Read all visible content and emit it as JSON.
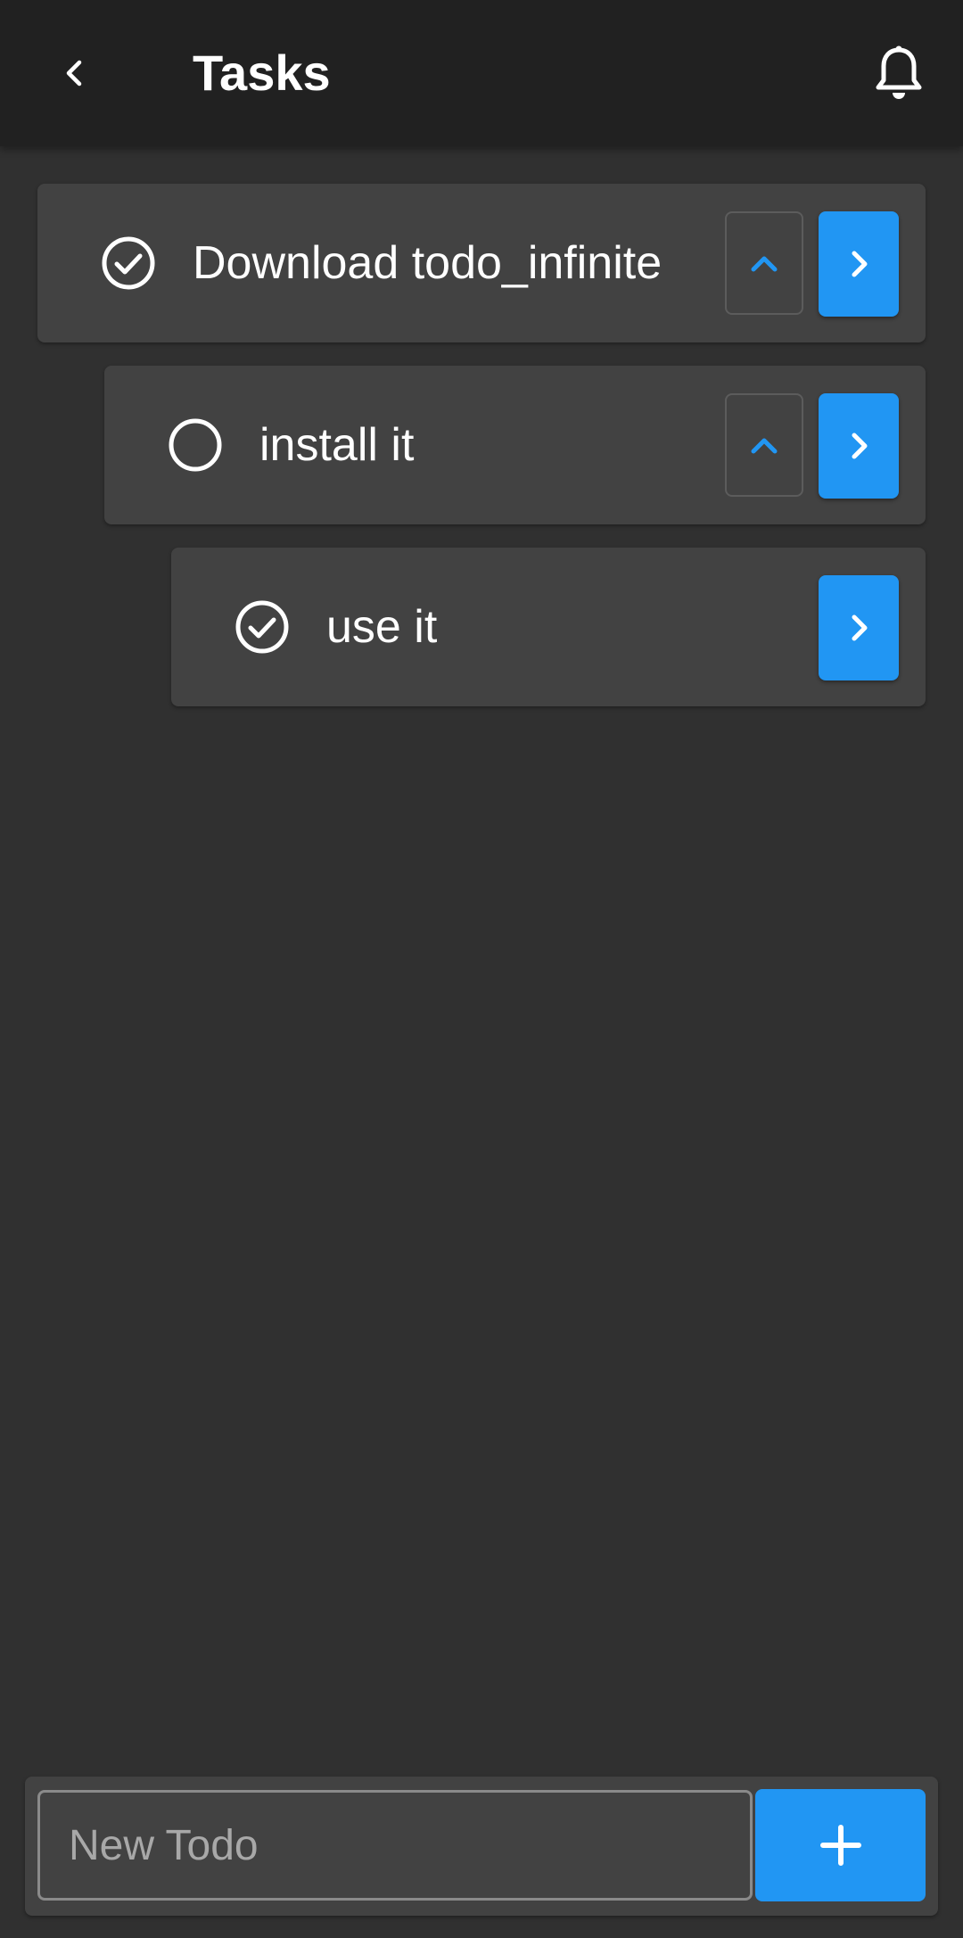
{
  "appbar": {
    "title": "Tasks",
    "back_icon": "chevron-left-icon",
    "bell_icon": "bell-icon"
  },
  "tasks": [
    {
      "label": "Download todo_infinite",
      "done": true,
      "level": 0,
      "has_up": true
    },
    {
      "label": "install it",
      "done": false,
      "level": 1,
      "has_up": true
    },
    {
      "label": "use it",
      "done": true,
      "level": 2,
      "has_up": false
    }
  ],
  "new_todo": {
    "placeholder": "New Todo",
    "value": ""
  },
  "colors": {
    "background": "#303030",
    "appbar": "#212121",
    "card": "#424242",
    "accent": "#2196f3"
  }
}
